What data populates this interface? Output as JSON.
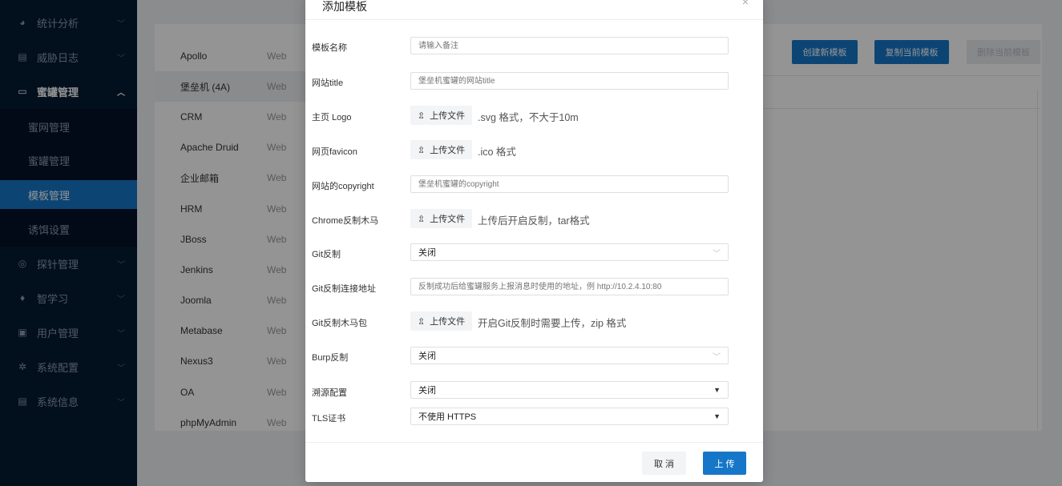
{
  "sidebar": {
    "items": [
      {
        "icon": "pie-chart-icon",
        "glyph": "◕",
        "label": "统计分析",
        "chev": "﹀"
      },
      {
        "icon": "log-icon",
        "glyph": "▤",
        "label": "威胁日志",
        "chev": "﹀"
      },
      {
        "icon": "jar-icon",
        "glyph": "▭",
        "label": "蜜罐管理",
        "chev": "︿"
      },
      {
        "icon": "probe-icon",
        "glyph": "◎",
        "label": "探针管理",
        "chev": "﹀"
      },
      {
        "icon": "bulb-icon",
        "glyph": "♦",
        "label": "智学习",
        "chev": "﹀"
      },
      {
        "icon": "user-icon",
        "glyph": "▣",
        "label": "用户管理",
        "chev": "﹀"
      },
      {
        "icon": "gear-icon",
        "glyph": "✲",
        "label": "系统配置",
        "chev": "﹀"
      },
      {
        "icon": "message-icon",
        "glyph": "▤",
        "label": "系统信息",
        "chev": "﹀"
      }
    ],
    "submenu": [
      "蜜网管理",
      "蜜罐管理",
      "模板管理",
      "诱饵设置"
    ]
  },
  "templates": [
    {
      "name": "Apollo",
      "type": "Web"
    },
    {
      "name": "堡垒机 (4A)",
      "type": "Web"
    },
    {
      "name": "CRM",
      "type": "Web"
    },
    {
      "name": "Apache Druid",
      "type": "Web"
    },
    {
      "name": "企业邮箱",
      "type": "Web"
    },
    {
      "name": "HRM",
      "type": "Web"
    },
    {
      "name": "JBoss",
      "type": "Web"
    },
    {
      "name": "Jenkins",
      "type": "Web"
    },
    {
      "name": "Joomla",
      "type": "Web"
    },
    {
      "name": "Metabase",
      "type": "Web"
    },
    {
      "name": "Nexus3",
      "type": "Web"
    },
    {
      "name": "OA",
      "type": "Web"
    },
    {
      "name": "phpMyAdmin",
      "type": "Web"
    }
  ],
  "toolbar": {
    "create": "创建新模板",
    "copy": "复制当前模板",
    "delete": "删除当前模板"
  },
  "modal": {
    "title": "添加模板",
    "close": "×",
    "fields": {
      "name": {
        "label": "模板名称",
        "placeholder": "请输入备注"
      },
      "title": {
        "label": "网站title",
        "placeholder": "堡垒机蜜罐的网站title"
      },
      "logo": {
        "label": "主页 Logo",
        "button": "上传文件",
        "hint": ".svg 格式，不大于10m"
      },
      "favicon": {
        "label": "网页favicon",
        "button": "上传文件",
        "hint": ".ico 格式"
      },
      "copyright": {
        "label": "网站的copyright",
        "placeholder": "堡垒机蜜罐的copyright"
      },
      "chrome": {
        "label": "Chrome反制木马",
        "button": "上传文件",
        "hint": "上传后开启反制，tar格式"
      },
      "git": {
        "label": "Git反制",
        "value": "关闭"
      },
      "git_addr": {
        "label": "Git反制连接地址",
        "placeholder": "反制成功后给蜜罐服务上报消息时使用的地址，例 http://10.2.4.10:80"
      },
      "git_pkg": {
        "label": "Git反制木马包",
        "button": "上传文件",
        "hint": "开启Git反制时需要上传，zip 格式"
      },
      "burp": {
        "label": "Burp反制",
        "value": "关闭"
      },
      "trace": {
        "label": "溯源配置",
        "value": "关闭"
      },
      "tls": {
        "label": "TLS证书",
        "value": "不使用 HTTPS"
      }
    },
    "cancel": "取 消",
    "upload": "上 传"
  },
  "colors": {
    "sidebar": "#041a33",
    "submenu": "#021226",
    "accent": "#1677c8"
  }
}
